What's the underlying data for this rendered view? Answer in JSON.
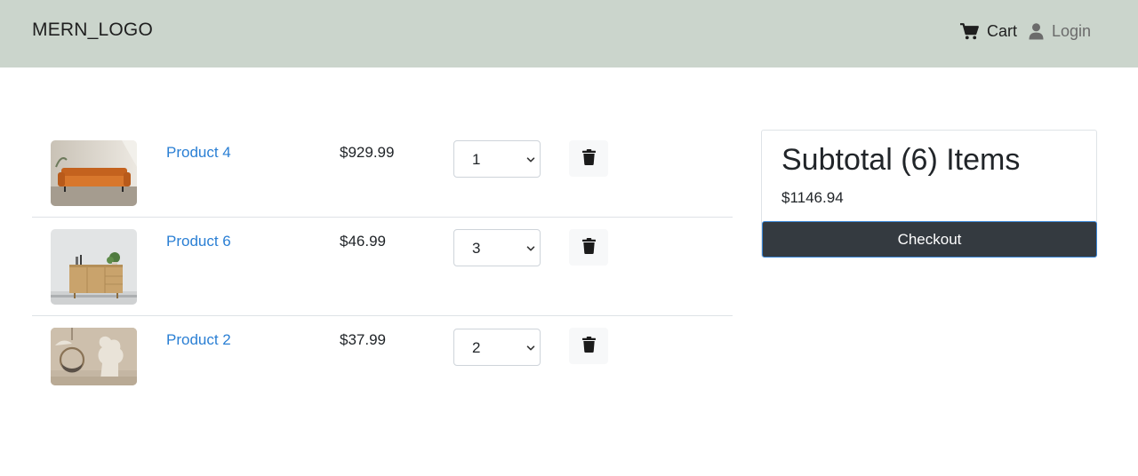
{
  "navbar": {
    "brand": "MERN_LOGO",
    "cart_label": "Cart",
    "login_label": "Login",
    "cart_icon": "shopping-cart-icon",
    "login_icon": "user-icon"
  },
  "cart": {
    "items": [
      {
        "name": "Product 4",
        "price": "$929.99",
        "qty": "1",
        "image": "orange-sofa"
      },
      {
        "name": "Product 6",
        "price": "$46.99",
        "qty": "3",
        "image": "wooden-dresser"
      },
      {
        "name": "Product 2",
        "price": "$37.99",
        "qty": "2",
        "image": "hanging-chair"
      }
    ]
  },
  "summary": {
    "title": "Subtotal (6) Items",
    "total": "$1146.94",
    "checkout_label": "Checkout"
  },
  "colors": {
    "navbar_bg": "#cbd5cc",
    "link": "#2a7fd4",
    "checkout_bg": "#343a40"
  }
}
